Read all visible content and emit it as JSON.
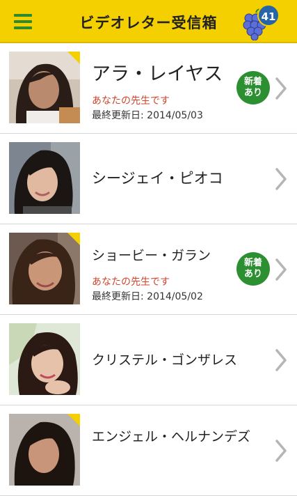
{
  "header": {
    "title": "ビデオレター受信箱",
    "badge_count": "41",
    "accent": "#f5d000",
    "menu_icon": "hamburger-menu-icon",
    "grape_icon": "grape-icon"
  },
  "list": {
    "items": [
      {
        "name": "アラ・レイヤス",
        "teacher_label": "あなたの先生です",
        "updated": "最終更新日: 2014/05/03",
        "new_label": "新着\nあり",
        "has_new": true
      },
      {
        "name": "シージェイ・ピオコ",
        "has_new": false
      },
      {
        "name": "ショービー・ガラン",
        "teacher_label": "あなたの先生です",
        "updated": "最終更新日: 2014/05/02",
        "new_label": "新着\nあり",
        "has_new": true
      },
      {
        "name": "クリステル・ゴンザレス",
        "has_new": false
      },
      {
        "name": "エンジェル・ヘルナンデズ",
        "has_new": false
      }
    ]
  }
}
